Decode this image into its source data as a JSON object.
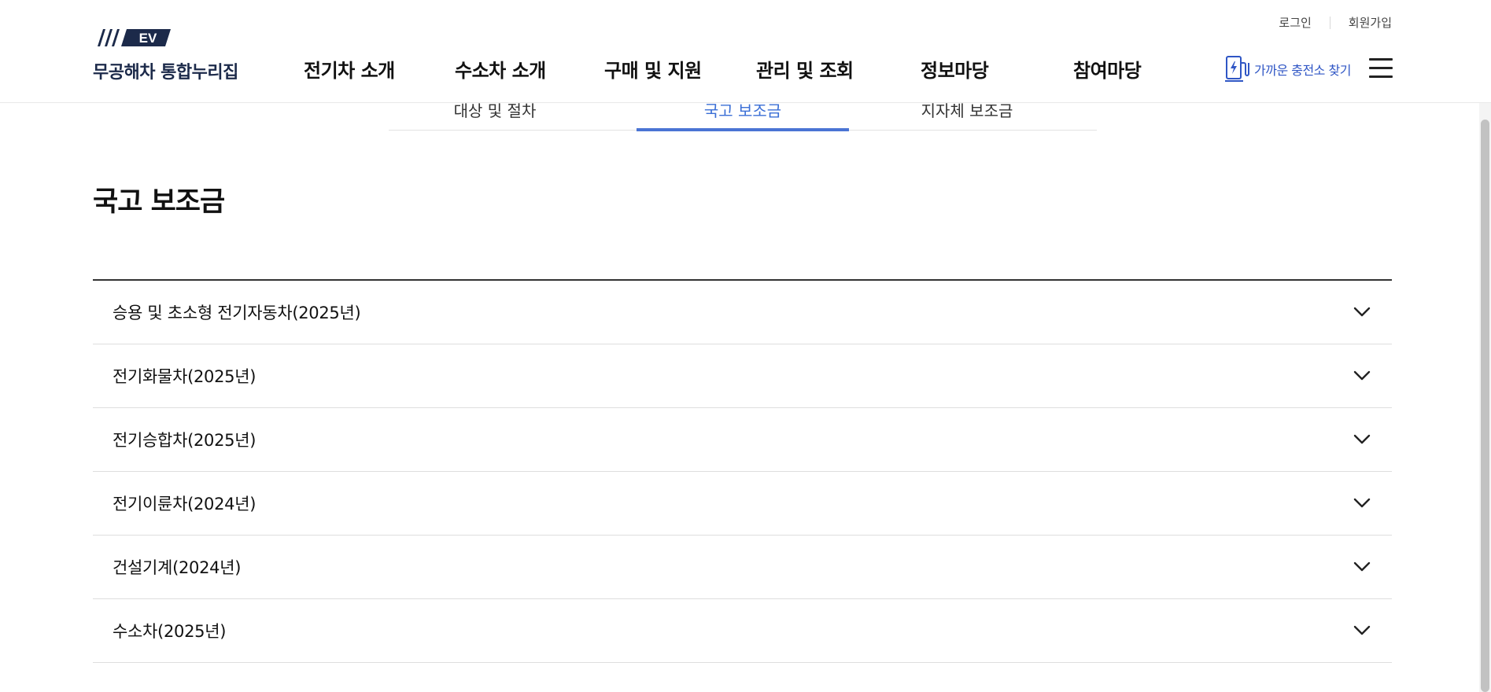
{
  "header": {
    "logo": {
      "badge": "EV",
      "name": "무공해차 통합누리집"
    },
    "util": {
      "login": "로그인",
      "signup": "회원가입"
    },
    "nav": [
      "전기차 소개",
      "수소차 소개",
      "구매 및 지원",
      "관리 및 조회",
      "정보마당",
      "참여마당"
    ],
    "charger_link": "가까운 충전소 찾기",
    "icons": {
      "charger": "ev-charger-icon",
      "menu": "hamburger-menu-icon"
    },
    "colors": {
      "brand_navy": "#1c2a4a",
      "link_blue": "#2f56c5"
    }
  },
  "subtabs": {
    "items": [
      "대상 및 절차",
      "국고 보조금",
      "지자체 보조금"
    ],
    "active_index": 1,
    "active_color": "#4a74d4"
  },
  "page_title": "국고 보조금",
  "accordion": {
    "items": [
      "승용 및 초소형 전기자동차(2025년)",
      "전기화물차(2025년)",
      "전기승합차(2025년)",
      "전기이륜차(2024년)",
      "건설기계(2024년)",
      "수소차(2025년)"
    ],
    "icon": "chevron-down-icon"
  }
}
